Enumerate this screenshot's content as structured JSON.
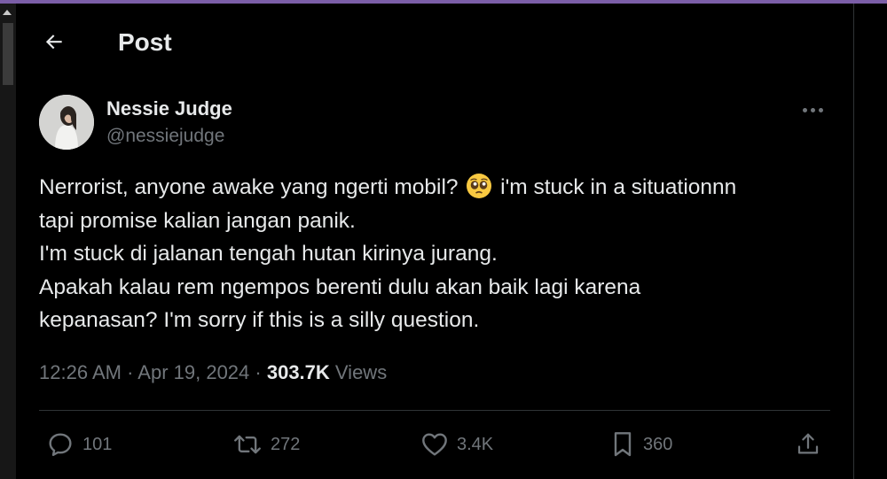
{
  "header": {
    "title": "Post"
  },
  "author": {
    "name": "Nessie Judge",
    "handle": "@nessiejudge"
  },
  "post": {
    "lines": [
      {
        "before": "Nerrorist, anyone awake yang ngerti mobil? ",
        "emoji": "pleading-face",
        "after": " i'm stuck in a situationnn"
      },
      {
        "text": "tapi promise kalian jangan panik."
      },
      {
        "text": "I'm stuck di jalanan tengah hutan kirinya jurang."
      },
      {
        "text": "Apakah kalau rem ngempos berenti dulu akan baik lagi karena"
      },
      {
        "text": "kepanasan? I'm sorry if this is a silly question."
      }
    ]
  },
  "meta": {
    "time": "12:26 AM",
    "sep1": " · ",
    "date": "Apr 19, 2024",
    "sep2": " · ",
    "views_count": "303.7K",
    "views_label": " Views"
  },
  "actions": {
    "replies": "101",
    "reposts": "272",
    "likes": "3.4K",
    "bookmarks": "360"
  },
  "icons": {
    "back": "arrow-left-icon",
    "more": "more-horizontal-icon",
    "reply": "reply-icon",
    "repost": "repost-icon",
    "like": "heart-icon",
    "bookmark": "bookmark-icon",
    "share": "share-icon"
  },
  "colors": {
    "background": "#000000",
    "text": "#e7e9ea",
    "muted": "#71767b",
    "divider": "#2f3336",
    "top_accent": "#7b5ea7"
  }
}
